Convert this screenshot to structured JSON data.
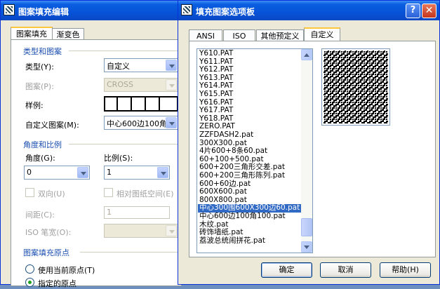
{
  "left_dialog": {
    "title": "图案填充编辑",
    "tabs": [
      {
        "label": "图案填充",
        "active": true
      },
      {
        "label": "渐变色",
        "active": false
      }
    ],
    "type_group": {
      "title": "类型和图案",
      "type_label": "类型(Y):",
      "type_value": "自定义",
      "pattern_label": "图案(P):",
      "pattern_value": "CROSS",
      "sample_label": "样例:",
      "custom_label": "自定义图案(M):",
      "custom_value": "中心600边100角"
    },
    "angle_group": {
      "title": "角度和比例",
      "angle_label": "角度(G):",
      "angle_value": "0",
      "scale_label": "比例(S):",
      "scale_value": "1",
      "double_label": "双向(U)",
      "relative_label": "相对图纸空间(E)",
      "spacing_label": "间距(C):",
      "spacing_value": "1",
      "iso_label": "ISO 笔宽(O):"
    },
    "origin_group": {
      "title": "图案填充原点",
      "use_current_label": "使用当前原点(T)",
      "specified_label": "指定的原点"
    }
  },
  "right_dialog": {
    "title": "填充图案选项板",
    "tabs": [
      {
        "label": "ANSI",
        "active": false
      },
      {
        "label": "ISO",
        "active": false
      },
      {
        "label": "其他预定义",
        "active": false
      },
      {
        "label": "自定义",
        "active": true
      }
    ],
    "patterns": [
      "Y610.PAT",
      "Y611.PAT",
      "Y612.PAT",
      "Y613.PAT",
      "Y614.PAT",
      "Y615.PAT",
      "Y616.PAT",
      "Y617.PAT",
      "Y618.PAT",
      "ZERO.PAT",
      "ZZFDASH2.pat",
      "300X300.pat",
      "4片600+8条60.pat",
      "60+100+500.pat",
      "600+200三角形交差.pat",
      "600+200三角形陈列.pat",
      "600+60边.pat",
      "600X600.pat",
      "800X800.pat",
      "中心300围600X300边60.pat",
      "中心600边100角100.pat",
      "木纹.pat",
      "砖饰墙纸.pat",
      "荔波总统闹拼花.pat"
    ],
    "selected_index": 19,
    "scroll_fraction": 0.97,
    "buttons": {
      "ok": "确定",
      "cancel": "取消",
      "help": "帮助(H)"
    }
  },
  "icons": {
    "title_icon": "hatch-app-icon",
    "help": "help-icon",
    "close": "close-icon"
  },
  "colors": {
    "titlebar": "#0a5fe0",
    "dialog_bg": "#ece9d8",
    "group_title": "#1a4eb0",
    "selection": "#316ac5"
  }
}
